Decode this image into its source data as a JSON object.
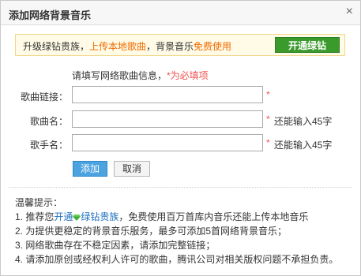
{
  "dialog": {
    "title": "添加网络背景音乐",
    "close_label": "×"
  },
  "promo": {
    "text_before": "升级绿钻贵族，",
    "highlight_upload": "上传本地歌曲",
    "text_middle": "，背景音乐",
    "highlight_free": "免费使用",
    "button_label": "开通绿钻"
  },
  "form": {
    "hint_text": "请填写网络歌曲信息，",
    "hint_required": "*为必填项",
    "fields": [
      {
        "label": "歌曲链接：",
        "value": "",
        "required_mark": "*",
        "limit_text": ""
      },
      {
        "label": "歌曲名：",
        "value": "",
        "required_mark": "*",
        "limit_text": "还能输入45字"
      },
      {
        "label": "歌手名：",
        "value": "",
        "required_mark": "*",
        "limit_text": "还能输入45字"
      }
    ],
    "add_label": "添加",
    "cancel_label": "取消"
  },
  "tips": {
    "heading": "温馨提示：",
    "line1_before": "1. 推荐您",
    "line1_link": "开通",
    "line1_link2": "绿钻贵族",
    "line1_after": "，免费使用百万首库内音乐还能上传本地音乐",
    "line2": "2. 为提供更稳定的背景音乐服务，最多可添加5首网络背景音乐；",
    "line3": "3. 网络歌曲存在不稳定因素，请添加完整链接；",
    "line4": "4. 请添加原创或经权利人许可的歌曲，腾讯公司对相关版权问题不承担负责。"
  },
  "colors": {
    "accent_green": "#3a9a2c",
    "highlight_orange": "#f16a00",
    "required_red": "#f05050",
    "button_blue": "#4ba3e0",
    "link_blue": "#1f6fbf"
  },
  "icons": {
    "close": "close-icon",
    "gem": "green-diamond-icon"
  }
}
